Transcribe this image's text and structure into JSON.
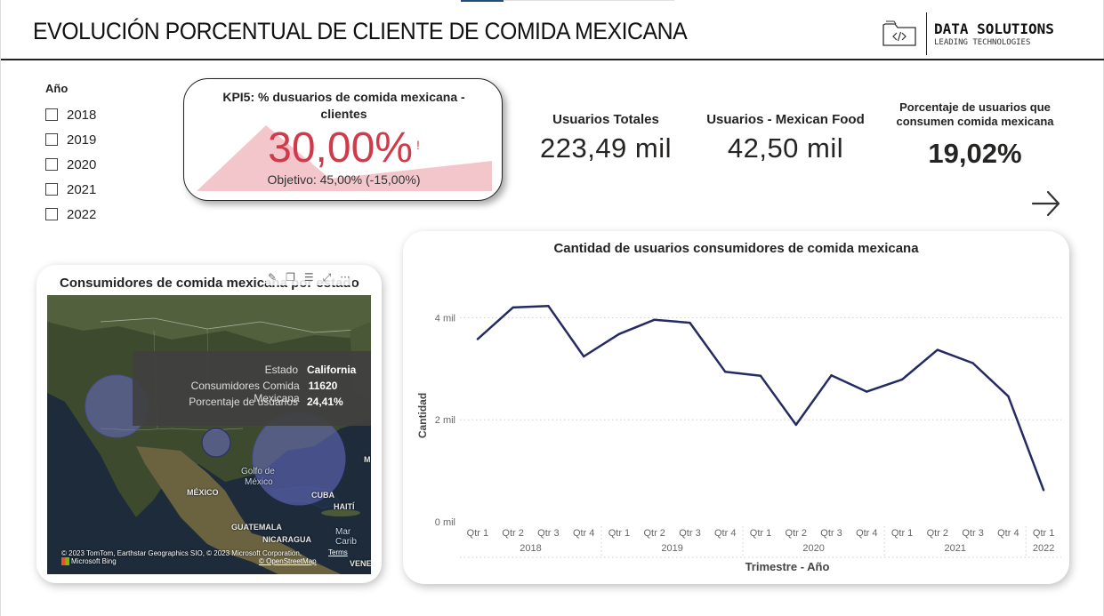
{
  "header": {
    "title": "EVOLUCIÓN PORCENTUAL DE CLIENTE DE COMIDA MEXICANA",
    "brand_name": "DATA SOLUTIONS",
    "brand_tagline": "LEADING TECHNOLOGIES",
    "logo_icon": "folder-code-icon"
  },
  "slicer": {
    "title": "Año",
    "items": [
      "2018",
      "2019",
      "2020",
      "2021",
      "2022"
    ]
  },
  "kpi": {
    "title": "KPI5: % dusuarios de comida mexicana - clientes",
    "value": "30,00%",
    "alert": "!",
    "goal": "Objetivo: 45,00% (-15,00%)",
    "value_color": "#d13a4a",
    "trend_color": "#f3c6cc"
  },
  "stats": {
    "total_label": "Usuarios Totales",
    "total_value": "223,49 mil",
    "mexican_label": "Usuarios - Mexican Food",
    "mexican_value": "42,50 mil",
    "pct_label_line1": "Porcentaje de usuarios que",
    "pct_label_line2": "consumen comida mexicana",
    "pct_value": "19,02%"
  },
  "nav": {
    "next_icon": "arrow-right-icon"
  },
  "map": {
    "title": "Consumidores de comida mexicana por estado",
    "toolbar_icons": [
      "pin-icon",
      "copy-icon",
      "filter-icon",
      "focus-mode-icon",
      "more-options-icon"
    ],
    "labels": {
      "mexico": "MÉXICO",
      "gulf1": "Golfo de",
      "gulf2": "México",
      "cuba": "CUBA",
      "haiti": "HAITÍ",
      "guatemala": "GUATEMALA",
      "nicaragua": "NICARAGUA",
      "caribbean": "Mar Carib",
      "venezuela": "VENE",
      "m_edge": "M"
    },
    "tooltip": {
      "state_label": "Estado",
      "state_value": "California",
      "consumers_label": "Consumidores Comida Mexicana",
      "consumers_value": "11620",
      "pct_label": "Porcentaje de usuarios",
      "pct_value": "24,41%"
    },
    "credit": "© 2023 TomTom, Earthstar Geographics SIO, © 2023 Microsoft Corporation,",
    "bing": "Microsoft Bing",
    "terms": "Terms",
    "osm": "© OpenStreetMap",
    "bubble_color": "#6a70c8"
  },
  "chart_data": {
    "type": "line",
    "title": "Cantidad de usuarios consumidores de comida mexicana",
    "xlabel": "Trimestre - Año",
    "ylabel": "Cantidad",
    "quarters": [
      "Qtr 1",
      "Qtr 2",
      "Qtr 3",
      "Qtr 4",
      "Qtr 1",
      "Qtr 2",
      "Qtr 3",
      "Qtr 4",
      "Qtr 1",
      "Qtr 2",
      "Qtr 3",
      "Qtr 4",
      "Qtr 1",
      "Qtr 2",
      "Qtr 3",
      "Qtr 4",
      "Qtr 1"
    ],
    "years": [
      {
        "label": "2018",
        "quarters": 4
      },
      {
        "label": "2019",
        "quarters": 4
      },
      {
        "label": "2020",
        "quarters": 4
      },
      {
        "label": "2021",
        "quarters": 4
      },
      {
        "label": "2022",
        "quarters": 1
      }
    ],
    "values": [
      3580,
      4200,
      4230,
      3240,
      3680,
      3960,
      3900,
      2940,
      2860,
      1900,
      2870,
      2550,
      2790,
      3370,
      3110,
      2460,
      620
    ],
    "yticks": [
      {
        "v": 0,
        "label": "0 mil"
      },
      {
        "v": 2000,
        "label": "2 mil"
      },
      {
        "v": 4000,
        "label": "4 mil"
      }
    ],
    "ylim": [
      0,
      5000
    ],
    "grid": true,
    "line_color": "#252a63"
  }
}
